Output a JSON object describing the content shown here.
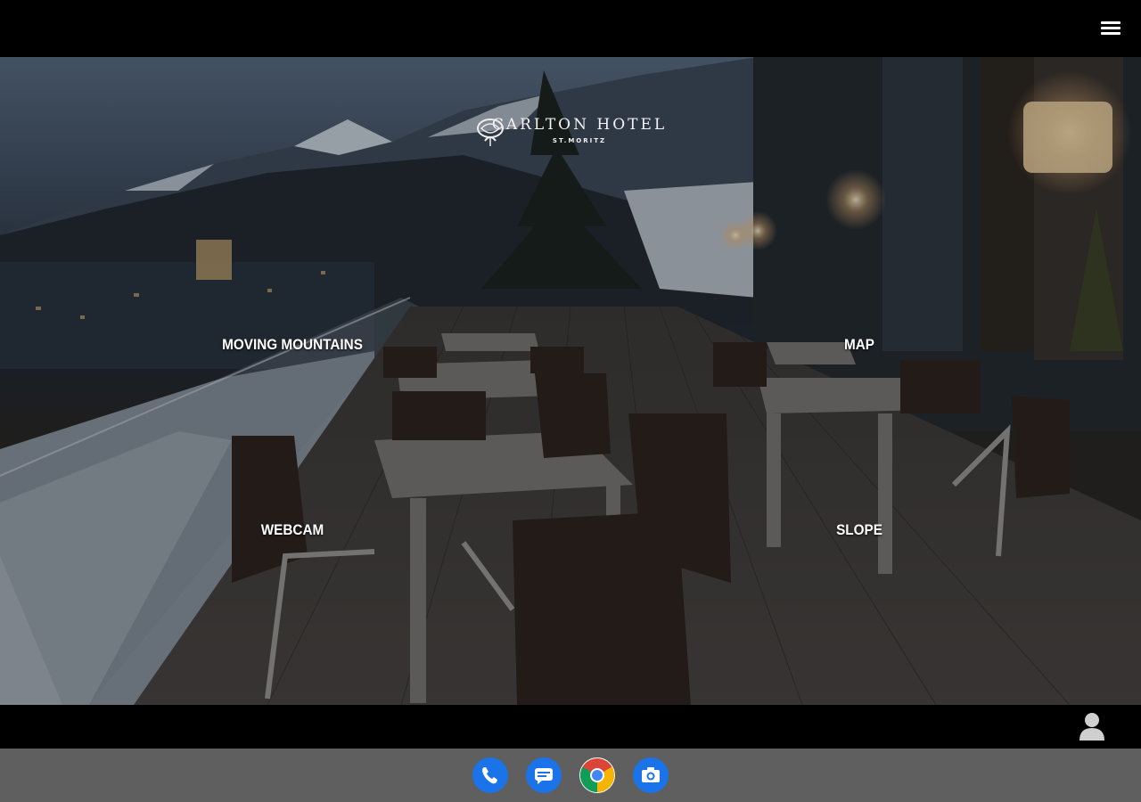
{
  "header": {
    "menu_icon": "hamburger-menu-icon"
  },
  "hero": {
    "brand_title": "CARLTON HOTEL",
    "brand_subtitle": "ST.MORITZ",
    "links": {
      "moving_mountains": "MOVING MOUNTAINS",
      "map": "MAP",
      "webcam": "WEBCAM",
      "slope": "SLOPE"
    }
  },
  "footer": {
    "account_icon": "account-person-icon"
  },
  "dock": {
    "apps": [
      {
        "name": "phone",
        "icon": "phone-icon",
        "color": "#1a73e8"
      },
      {
        "name": "messages",
        "icon": "messages-icon",
        "color": "#1a73e8"
      },
      {
        "name": "chrome",
        "icon": "chrome-icon",
        "color": "#ffffff"
      },
      {
        "name": "camera",
        "icon": "camera-icon",
        "color": "#1a73e8"
      }
    ]
  }
}
